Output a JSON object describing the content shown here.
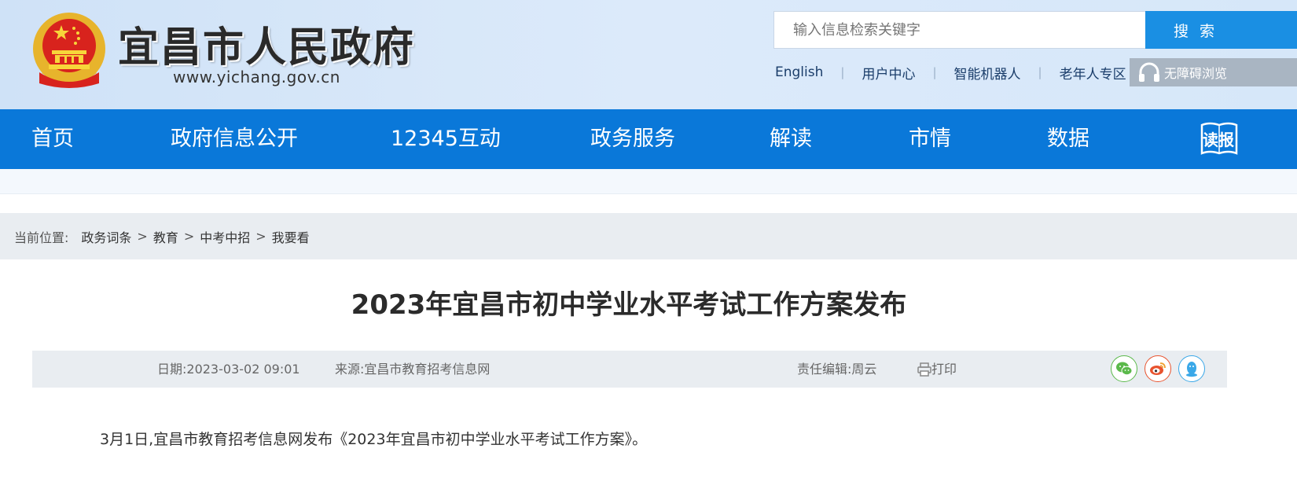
{
  "header": {
    "site_title": "宜昌市人民政府",
    "site_url": "www.yichang.gov.cn",
    "search_placeholder": "输入信息检索关键字",
    "search_button": "搜 索",
    "links": [
      "English",
      "用户中心",
      "智能机器人",
      "老年人专区"
    ],
    "accessibility_label": "无障碍浏览",
    "colors": {
      "header_bg": "#d6e7f9",
      "search_button": "#1a8fe3"
    },
    "icons": {
      "emblem": "national-emblem-icon",
      "accessibility": "headphones-icon"
    }
  },
  "nav": {
    "items": [
      "首页",
      "政府信息公开",
      "12345互动",
      "政务服务",
      "解读",
      "市情",
      "数据"
    ],
    "read_label": "读报",
    "color": "#0a78d9"
  },
  "breadcrumb": {
    "label": "当前位置:",
    "items": [
      "政务词条",
      "教育",
      "中考中招",
      "我要看"
    ],
    "separator": ">"
  },
  "article": {
    "title": "2023年宜昌市初中学业水平考试工作方案发布",
    "date_text": "日期:2023-03-02 09:01",
    "source_text": "来源:宜昌市教育招考信息网",
    "editor_text": "责任编辑:周云",
    "print_label": "打印",
    "share_icons": [
      "wechat-icon",
      "weibo-icon",
      "qq-icon"
    ],
    "paragraph": "3月1日,宜昌市教育招考信息网发布《2023年宜昌市初中学业水平考试工作方案》。"
  }
}
